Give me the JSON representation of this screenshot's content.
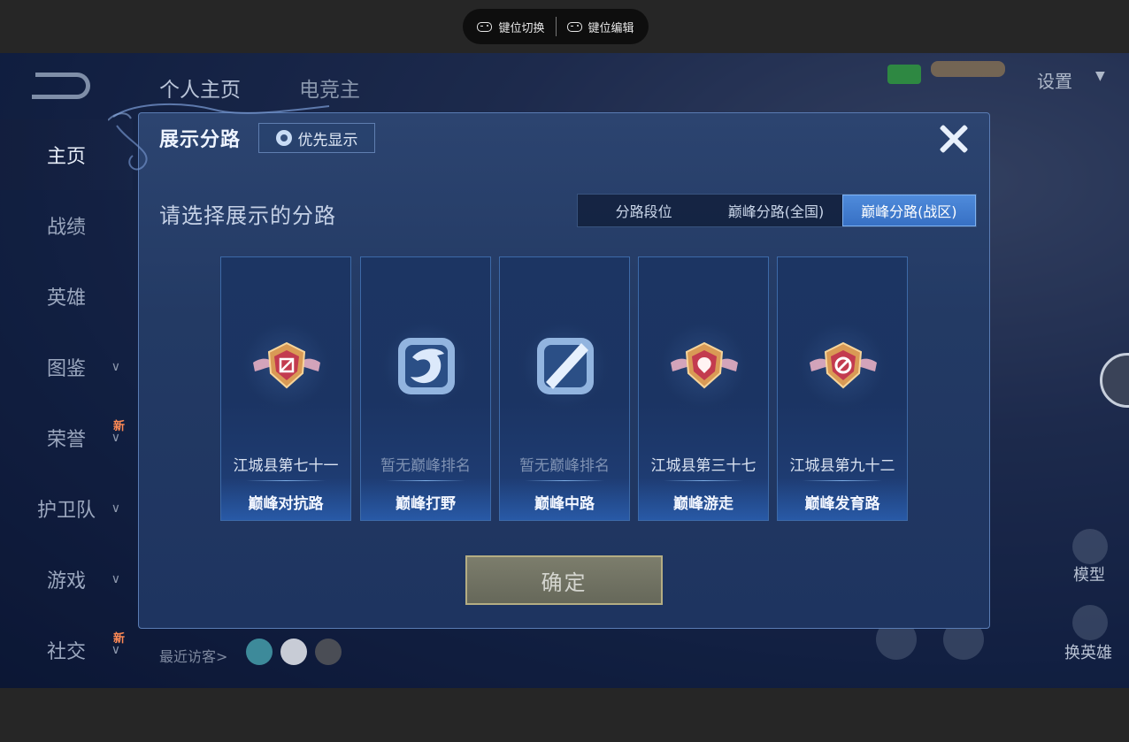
{
  "toolbar": {
    "key_switch": "键位切换",
    "key_edit": "键位编辑"
  },
  "background": {
    "tabs": [
      "个人主页",
      "电竞主"
    ],
    "sidebar": [
      {
        "label": "主页",
        "active": true,
        "chevron": false,
        "new": false
      },
      {
        "label": "战绩",
        "active": false,
        "chevron": false,
        "new": false
      },
      {
        "label": "英雄",
        "active": false,
        "chevron": false,
        "new": false
      },
      {
        "label": "图鉴",
        "active": false,
        "chevron": true,
        "new": false
      },
      {
        "label": "荣誉",
        "active": false,
        "chevron": true,
        "new": true
      },
      {
        "label": "护卫队",
        "active": false,
        "chevron": true,
        "new": false
      },
      {
        "label": "游戏",
        "active": false,
        "chevron": true,
        "new": false
      },
      {
        "label": "社交",
        "active": false,
        "chevron": true,
        "new": true
      }
    ],
    "new_tag": "新",
    "settings_label": "设置",
    "visitors_label": "最近访客>",
    "right_labels": {
      "model": "模型",
      "swap_hero": "换英雄"
    }
  },
  "modal": {
    "title": "展示分路",
    "priority_button": "优先显示",
    "prompt": "请选择展示的分路",
    "tabs": [
      {
        "label": "分路段位",
        "selected": false
      },
      {
        "label": "巅峰分路(全国)",
        "selected": false
      },
      {
        "label": "巅峰分路(战区)",
        "selected": true
      }
    ],
    "cards": [
      {
        "rank": "江城县第七十一",
        "lane": "巅峰对抗路",
        "ranked": true,
        "icon": "clash-lane-emblem-icon"
      },
      {
        "rank": "暂无巅峰排名",
        "lane": "巅峰打野",
        "ranked": false,
        "icon": "jungle-dragon-icon"
      },
      {
        "rank": "暂无巅峰排名",
        "lane": "巅峰中路",
        "ranked": false,
        "icon": "mid-lane-icon"
      },
      {
        "rank": "江城县第三十七",
        "lane": "巅峰游走",
        "ranked": true,
        "icon": "roam-emblem-icon"
      },
      {
        "rank": "江城县第九十二",
        "lane": "巅峰发育路",
        "ranked": true,
        "icon": "farm-lane-emblem-icon"
      }
    ],
    "confirm": "确定"
  }
}
